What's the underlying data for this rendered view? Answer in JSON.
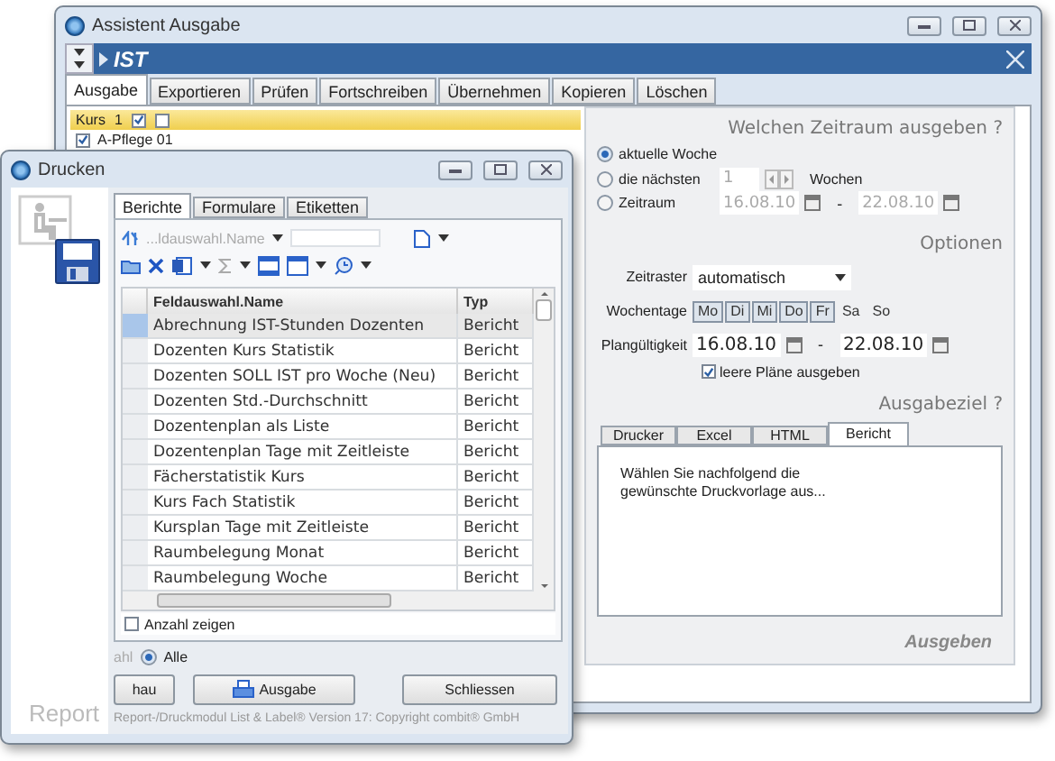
{
  "assistant": {
    "title": "Assistent Ausgabe",
    "header": "IST",
    "tabs": [
      {
        "label": "Ausgabe",
        "selected": true
      },
      {
        "label": "Exportieren",
        "selected": false
      },
      {
        "label": "Prüfen",
        "selected": false
      },
      {
        "label": "Fortschreiben",
        "selected": false
      },
      {
        "label": "Übernehmen",
        "selected": false
      },
      {
        "label": "Kopieren",
        "selected": false
      },
      {
        "label": "Löschen",
        "selected": false
      }
    ],
    "course_list": {
      "label": "Kurs",
      "count": "1",
      "header_checks": [
        {
          "checked": true
        },
        {
          "checked": false
        }
      ],
      "items": [
        {
          "label": "A-Pflege 01",
          "checked": true
        }
      ]
    },
    "period": {
      "heading": "Welchen Zeitraum ausgeben ?",
      "options": [
        {
          "kind": "plain",
          "label": "aktuelle Woche",
          "selected": true
        },
        {
          "kind": "weeks",
          "label": "die nächsten",
          "selected": false,
          "value": "1",
          "unit": "Wochen"
        },
        {
          "kind": "range",
          "label": "Zeitraum",
          "selected": false,
          "from": "16.08.10",
          "to": "22.08.10"
        }
      ]
    },
    "options": {
      "heading": "Optionen",
      "grid_label": "Zeitraster",
      "grid_value": "automatisch",
      "weekdays_label": "Wochentage",
      "weekdays": [
        {
          "label": "Mo",
          "selected": true
        },
        {
          "label": "Di",
          "selected": true
        },
        {
          "label": "Mi",
          "selected": true
        },
        {
          "label": "Do",
          "selected": true
        },
        {
          "label": "Fr",
          "selected": true
        },
        {
          "label": "Sa",
          "selected": false
        },
        {
          "label": "So",
          "selected": false
        }
      ],
      "validity_label": "Plangültigkeit",
      "validity_from": "16.08.10",
      "validity_to": "22.08.10",
      "dash": "-",
      "empty_plans": {
        "label": "leere Pläne ausgeben",
        "checked": true
      }
    },
    "target": {
      "heading": "Ausgabeziel ?",
      "tabs": [
        {
          "label": "Drucker",
          "selected": false
        },
        {
          "label": "Excel",
          "selected": false
        },
        {
          "label": "HTML",
          "selected": false
        },
        {
          "label": "Bericht",
          "selected": true
        }
      ],
      "message": "Wählen Sie nachfolgend die gewünschte Druckvorlage aus..."
    },
    "action": "Ausgeben"
  },
  "print_dialog": {
    "title": "Drucken",
    "side_label": "Report",
    "tabs": [
      {
        "label": "Berichte",
        "selected": true
      },
      {
        "label": "Formulare",
        "selected": false
      },
      {
        "label": "Etiketten",
        "selected": false
      }
    ],
    "field_select": "...ldauswahl.Name",
    "columns": [
      "Feldauswahl.Name",
      "Typ"
    ],
    "rows": [
      {
        "name": "Abrechnung IST-Stunden Dozenten",
        "type": "Bericht",
        "selected": true
      },
      {
        "name": "Dozenten Kurs Statistik",
        "type": "Bericht",
        "selected": false
      },
      {
        "name": "Dozenten SOLL IST pro Woche (Neu)",
        "type": "Bericht",
        "selected": false
      },
      {
        "name": "Dozenten Std.-Durchschnitt",
        "type": "Bericht",
        "selected": false
      },
      {
        "name": "Dozentenplan als Liste",
        "type": "Bericht",
        "selected": false
      },
      {
        "name": "Dozentenplan Tage mit Zeitleiste",
        "type": "Bericht",
        "selected": false
      },
      {
        "name": "Fächerstatistik Kurs",
        "type": "Bericht",
        "selected": false
      },
      {
        "name": "Kurs Fach Statistik",
        "type": "Bericht",
        "selected": false
      },
      {
        "name": "Kursplan Tage mit Zeitleiste",
        "type": "Bericht",
        "selected": false
      },
      {
        "name": "Raumbelegung Monat",
        "type": "Bericht",
        "selected": false
      },
      {
        "name": "Raumbelegung Woche",
        "type": "Bericht",
        "selected": false
      }
    ],
    "count_checkbox": {
      "label": "Anzahl zeigen",
      "checked": false
    },
    "scope": {
      "cut_label": "ahl",
      "option": {
        "label": "Alle",
        "selected": true
      }
    },
    "buttons": [
      "hau",
      "Ausgabe",
      "Schliessen"
    ],
    "footer": "Report-/Druckmodul List & Label® Version 17: Copyright combit® GmbH"
  }
}
